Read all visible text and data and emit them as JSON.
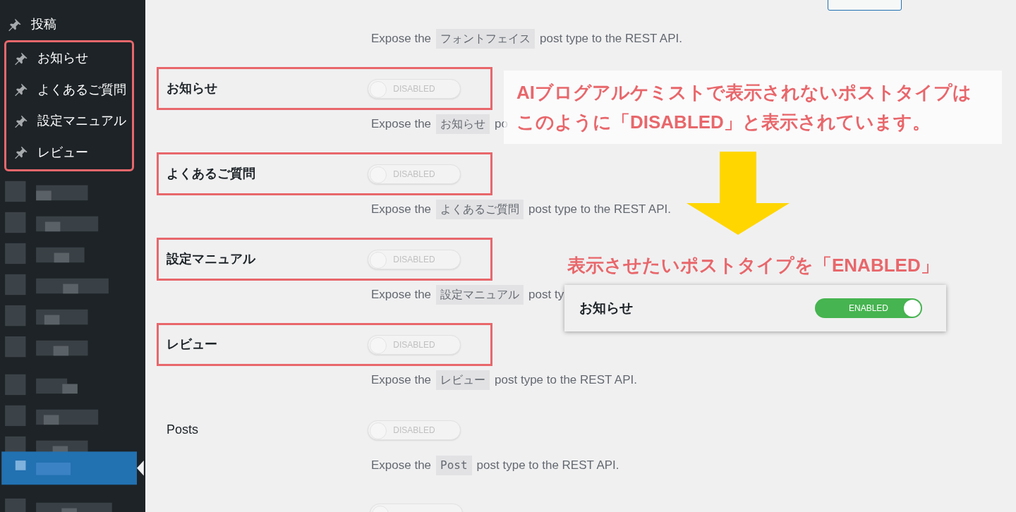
{
  "sidebar": {
    "items": [
      {
        "label": "投稿",
        "highlighted": false
      },
      {
        "label": "お知らせ",
        "highlighted": true
      },
      {
        "label": "よくあるご質問",
        "highlighted": true
      },
      {
        "label": "設定マニュアル",
        "highlighted": true
      },
      {
        "label": "レビュー",
        "highlighted": true
      }
    ]
  },
  "settings": {
    "cut_off_button": {
      "kind": "button"
    },
    "intro_description": {
      "before": "Expose the",
      "code": "フォントフェイス",
      "after": "post type to the REST API."
    },
    "rows": [
      {
        "label": "お知らせ",
        "highlighted": true,
        "toggle": {
          "on": false,
          "label": "DISABLED"
        },
        "description": {
          "before": "Expose the",
          "code": "お知らせ",
          "after": "po"
        }
      },
      {
        "label": "よくあるご質問",
        "highlighted": true,
        "toggle": {
          "on": false,
          "label": "DISABLED"
        },
        "description": {
          "before": "Expose the",
          "code": "よくあるご質問",
          "after": "post type to the REST API."
        }
      },
      {
        "label": "設定マニュアル",
        "highlighted": true,
        "toggle": {
          "on": false,
          "label": "DISABLED"
        },
        "description": {
          "before": "Expose the",
          "code": "設定マニュアル",
          "after": "post ty"
        }
      },
      {
        "label": "レビュー",
        "highlighted": true,
        "toggle": {
          "on": false,
          "label": "DISABLED"
        },
        "description": {
          "before": "Expose the",
          "code": "レビュー",
          "after": "post type to the REST API."
        }
      },
      {
        "label": "Posts",
        "highlighted": false,
        "toggle": {
          "on": false,
          "label": "DISABLED"
        },
        "description": {
          "before": "Expose the",
          "code": "Post",
          "code_mono": true,
          "after": "post type to the REST API."
        }
      }
    ],
    "partial_row": {
      "toggle": {
        "on": false
      }
    }
  },
  "annotations": {
    "callout": {
      "lines": [
        "AIブログアルケミストで表示されないポストタイプは",
        "このように「DISABLED」と表示されています。"
      ]
    },
    "arrow": {
      "kind": "arrow"
    },
    "caption": "表示させたいポストタイプを「ENABLED」",
    "example": {
      "label": "お知らせ",
      "toggle": {
        "on": true,
        "label": "ENABLED"
      }
    }
  }
}
